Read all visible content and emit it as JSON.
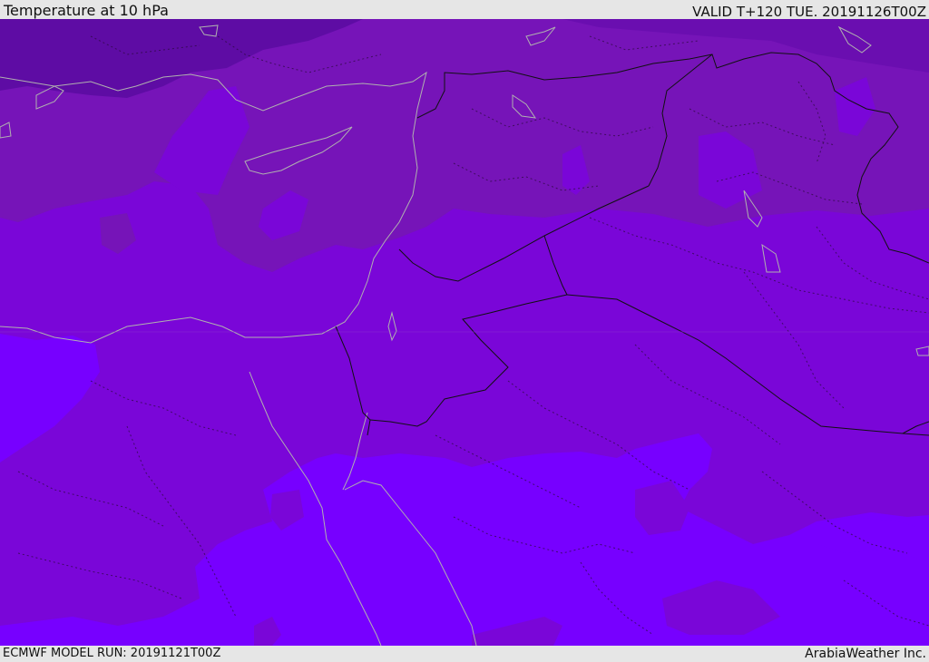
{
  "header": {
    "title": "Temperature at 10 hPa",
    "valid_label": "VALID T+120 TUE. 20191126T00Z"
  },
  "footer": {
    "model_run": "ECMWF MODEL RUN: 20191121T00Z",
    "credit": "ArabiaWeather Inc."
  },
  "map": {
    "colors": {
      "darkest": "#5a0aa0",
      "dark": "#6a10b0",
      "mid_dark": "#7612b8",
      "mid": "#7a06d8",
      "light": "#7700ff",
      "coastline": "#b0b0b0",
      "border": "#111111"
    }
  }
}
